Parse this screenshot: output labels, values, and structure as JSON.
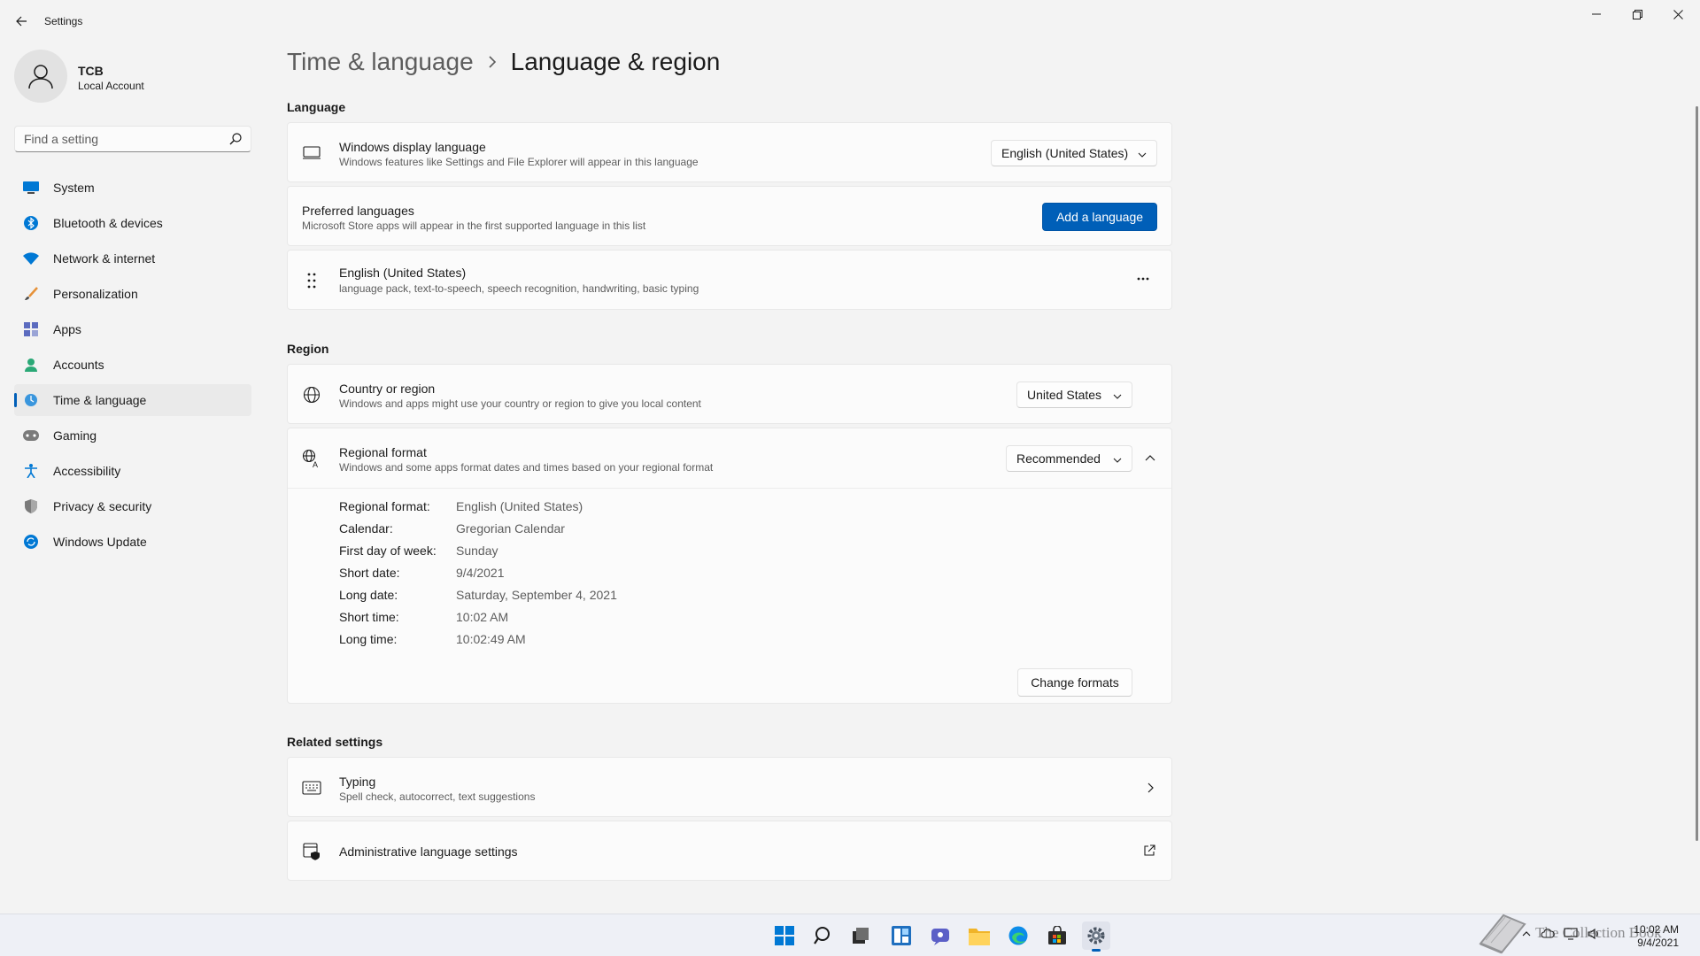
{
  "window": {
    "app_title": "Settings"
  },
  "profile": {
    "name": "TCB",
    "account_type": "Local Account"
  },
  "search": {
    "placeholder": "Find a setting"
  },
  "nav": {
    "items": [
      {
        "label": "System",
        "icon": "system-icon"
      },
      {
        "label": "Bluetooth & devices",
        "icon": "bluetooth-icon"
      },
      {
        "label": "Network & internet",
        "icon": "wifi-icon"
      },
      {
        "label": "Personalization",
        "icon": "brush-icon"
      },
      {
        "label": "Apps",
        "icon": "apps-icon"
      },
      {
        "label": "Accounts",
        "icon": "person-icon"
      },
      {
        "label": "Time & language",
        "icon": "globe-clock-icon",
        "selected": true
      },
      {
        "label": "Gaming",
        "icon": "gamepad-icon"
      },
      {
        "label": "Accessibility",
        "icon": "accessibility-icon"
      },
      {
        "label": "Privacy & security",
        "icon": "shield-icon"
      },
      {
        "label": "Windows Update",
        "icon": "update-icon"
      }
    ]
  },
  "breadcrumb": {
    "parent": "Time & language",
    "current": "Language & region"
  },
  "language": {
    "section_title": "Language",
    "display_language": {
      "title": "Windows display language",
      "desc": "Windows features like Settings and File Explorer will appear in this language",
      "value": "English (United States)"
    },
    "preferred": {
      "title": "Preferred languages",
      "desc": "Microsoft Store apps will appear in the first supported language in this list",
      "button": "Add a language"
    },
    "installed": {
      "title": "English (United States)",
      "desc": "language pack, text-to-speech, speech recognition, handwriting, basic typing",
      "more": "···"
    }
  },
  "region": {
    "section_title": "Region",
    "country": {
      "title": "Country or region",
      "desc": "Windows and apps might use your country or region to give you local content",
      "value": "United States"
    },
    "format": {
      "title": "Regional format",
      "desc": "Windows and some apps format dates and times based on your regional format",
      "value": "Recommended",
      "details": [
        {
          "key": "Regional format:",
          "value": "English (United States)"
        },
        {
          "key": "Calendar:",
          "value": "Gregorian Calendar"
        },
        {
          "key": "First day of week:",
          "value": "Sunday"
        },
        {
          "key": "Short date:",
          "value": "9/4/2021"
        },
        {
          "key": "Long date:",
          "value": "Saturday, September 4, 2021"
        },
        {
          "key": "Short time:",
          "value": "10:02 AM"
        },
        {
          "key": "Long time:",
          "value": "10:02:49 AM"
        }
      ],
      "change_button": "Change formats"
    }
  },
  "related": {
    "section_title": "Related settings",
    "typing": {
      "title": "Typing",
      "desc": "Spell check, autocorrect, text suggestions"
    },
    "admin": {
      "title": "Administrative language settings"
    }
  },
  "taskbar": {
    "time": "10:02 AM",
    "date": "9/4/2021",
    "watermark": "The Collection Book"
  },
  "colors": {
    "accent": "#005fb8",
    "background": "#f3f3f3",
    "card": "#fbfbfb"
  }
}
